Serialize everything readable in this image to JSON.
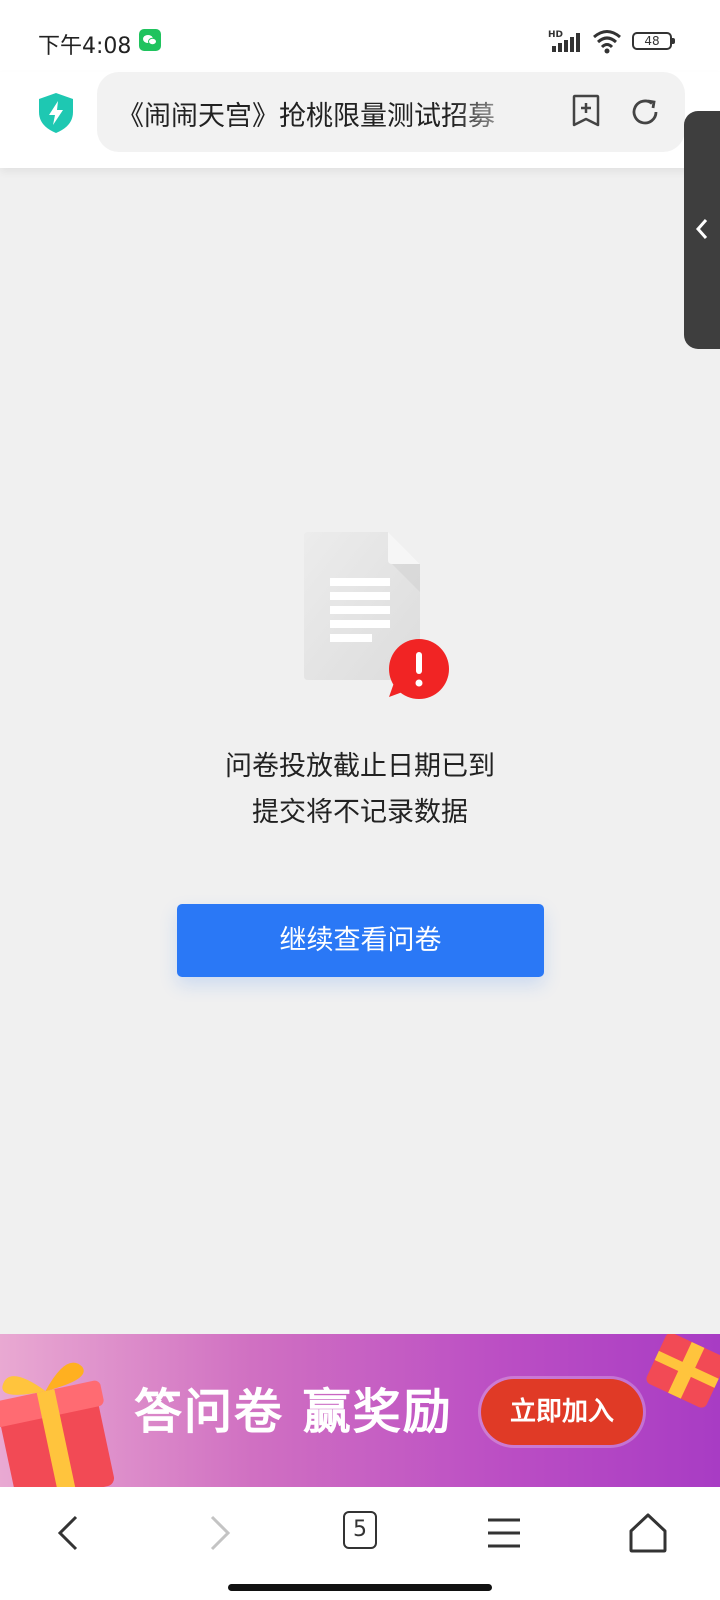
{
  "status_bar": {
    "time": "下午4:08",
    "battery": "48",
    "icons": [
      "wechat-icon",
      "hd-signal-icon",
      "wifi-icon",
      "battery-icon"
    ]
  },
  "browser": {
    "url_title": "《闹闹天宫》抢桃限量测试招募",
    "icons": [
      "shield-bolt-icon",
      "bookmark-add-icon",
      "reload-icon"
    ],
    "accent": "#1ec8b2"
  },
  "side_panel": {
    "icon": "chevron-left-icon"
  },
  "content": {
    "message_line1": "问卷投放截止日期已到",
    "message_line2": "提交将不记录数据",
    "continue_button": "继续查看问卷",
    "button_color": "#2a78f6",
    "illustration": "document-warning-icon"
  },
  "banner": {
    "text": "答问卷 赢奖励",
    "join_button": "立即加入",
    "icons": [
      "gift-box-icon"
    ]
  },
  "bottom_nav": {
    "tab_count": "5",
    "icons": [
      "back-icon",
      "forward-icon",
      "tabs-icon",
      "menu-icon",
      "home-icon"
    ]
  }
}
